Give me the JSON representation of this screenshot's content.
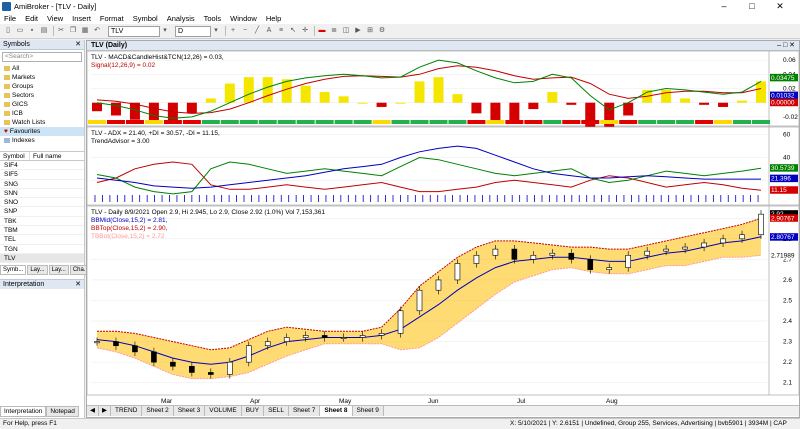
{
  "app": {
    "title": "AmiBroker - [TLV - Daily]",
    "minimize": "–",
    "maximize": "□",
    "close": "✕"
  },
  "menu": [
    "File",
    "Edit",
    "View",
    "Insert",
    "Format",
    "Symbol",
    "Analysis",
    "Tools",
    "Window",
    "Help"
  ],
  "toolbar": {
    "ticker": "TLV",
    "interval": "D"
  },
  "symbols_panel": {
    "title": "Symbols",
    "close": "✕",
    "search_placeholder": "<Search>",
    "tree": [
      "All",
      "Markets",
      "Groups",
      "Sectors",
      "GICS",
      "ICB",
      "Watch Lists",
      "Favourites",
      "Indexes"
    ],
    "col_symbol": "Symbol",
    "col_fullname": "Full name",
    "list": [
      "SIF4",
      "SIF5",
      "SNG",
      "SNN",
      "SNO",
      "SNP",
      "TBK",
      "TBM",
      "TEL",
      "TGN",
      "TLV"
    ],
    "tabs": [
      "Symb...",
      "Lay...",
      "Lay...",
      "Cha..."
    ]
  },
  "interpretation": {
    "title": "Interpretation",
    "close": "✕",
    "tabs": [
      "Interpretation",
      "Notepad"
    ]
  },
  "chart_window": {
    "title": "TLV (Daily)",
    "buttons": "– □ ✕"
  },
  "sheet_nav": [
    "◀",
    "▶"
  ],
  "sheets": [
    "TREND",
    "Sheet 2",
    "Sheet 3",
    "VOLUME",
    "BUY",
    "SELL",
    "Sheet 7",
    "Sheet 8",
    "Sheet 9"
  ],
  "active_sheet": "Sheet 8",
  "status": {
    "left": "For Help, press F1",
    "right": "X: 5/10/2021 | Y: 2.6151 | Undefined, Group 255, Services, Advertising | bvb5901 | 3934M | CAP"
  },
  "colors": {
    "up": "#000000",
    "down": "#d40000",
    "band": "#ffc000",
    "mid": "#0000c0",
    "top": "#c00000",
    "bot": "#ff9999",
    "macd": "#008000",
    "signal": "#c00000",
    "adx": "#0000c0",
    "pdi": "#008000",
    "mdi": "#c00000"
  },
  "chart_data": [
    {
      "type": "bar",
      "title": "TLV - MACD&CandleHist&TCN(12,26) = 0.03,",
      "subtitle": "Signal(12,26,9) = 0.02",
      "ylim": [
        -0.03,
        0.07
      ],
      "yticks": [
        0.06,
        0.04,
        0.02,
        0.0,
        -0.02
      ],
      "value_labels": [
        "0.03475",
        "0.01032",
        "0.00000"
      ],
      "series": [
        {
          "name": "MACD",
          "values": [
            0.0,
            -0.004,
            -0.01,
            -0.018,
            -0.022,
            -0.02,
            -0.012,
            0.0,
            0.012,
            0.022,
            0.03,
            0.035,
            0.038,
            0.04,
            0.038,
            0.035,
            0.036,
            0.05,
            0.06,
            0.056,
            0.045,
            0.035,
            0.028,
            0.03,
            0.04,
            0.035,
            0.01,
            -0.01,
            0.0,
            0.015,
            0.02,
            0.018,
            0.015,
            0.012,
            0.015,
            0.03
          ]
        },
        {
          "name": "Signal",
          "values": [
            0.004,
            0.002,
            -0.002,
            -0.008,
            -0.013,
            -0.015,
            -0.014,
            -0.009,
            0.0,
            0.01,
            0.019,
            0.027,
            0.033,
            0.037,
            0.038,
            0.037,
            0.036,
            0.04,
            0.048,
            0.052,
            0.05,
            0.045,
            0.038,
            0.033,
            0.035,
            0.036,
            0.027,
            0.012,
            0.006,
            0.009,
            0.014,
            0.016,
            0.016,
            0.014,
            0.014,
            0.02
          ]
        }
      ]
    },
    {
      "type": "line",
      "title": "TLV - ADX = 21.40, +DI = 30.57, -DI = 11.15,",
      "subtitle": "TrendAdvisor = 3.00",
      "ylim": [
        0,
        65
      ],
      "yticks": [
        60,
        40,
        20
      ],
      "value_labels": [
        "30.5739",
        "21.396",
        "11.15"
      ],
      "series": [
        {
          "name": "ADX",
          "values": [
            22,
            20,
            18,
            15,
            14,
            13,
            14,
            16,
            18,
            20,
            22,
            24,
            27,
            30,
            32,
            34,
            40,
            45,
            48,
            50,
            48,
            42,
            36,
            30,
            26,
            24,
            22,
            22,
            23,
            24,
            23,
            22,
            21,
            21,
            21,
            21
          ]
        },
        {
          "name": "+DI",
          "values": [
            25,
            22,
            14,
            10,
            8,
            10,
            30,
            36,
            34,
            30,
            26,
            28,
            30,
            28,
            26,
            24,
            32,
            40,
            38,
            34,
            30,
            26,
            24,
            26,
            28,
            30,
            22,
            18,
            20,
            24,
            28,
            26,
            24,
            26,
            28,
            30.6
          ]
        },
        {
          "name": "-DI",
          "values": [
            18,
            22,
            30,
            34,
            36,
            34,
            16,
            12,
            12,
            14,
            16,
            14,
            12,
            14,
            16,
            18,
            14,
            10,
            10,
            12,
            14,
            18,
            20,
            18,
            16,
            14,
            20,
            24,
            22,
            18,
            14,
            16,
            18,
            16,
            13,
            11.2
          ]
        }
      ]
    },
    {
      "type": "line",
      "title": "TLV - Daily 8/9/2021 Open 2.9, Hi 2.945, Lo 2.9, Close 2.92 (1.0%) Vol 7,153,361",
      "legend": [
        "BBMid(Close,15,2) = 2.81,",
        "BBTop(Close,15,2) = 2.90,",
        "TBBot(Close,15,2) = 2.72"
      ],
      "ylim": [
        2.05,
        2.95
      ],
      "yticks": [
        2.9,
        2.8,
        2.7,
        2.6,
        2.5,
        2.4,
        2.3,
        2.2,
        2.1
      ],
      "value_labels": [
        "2.92",
        "2.90767",
        "2.80767",
        "2.71989"
      ],
      "x_labels": [
        "Mar",
        "Apr",
        "May",
        "Jun",
        "Jul",
        "Aug"
      ],
      "close": [
        2.3,
        2.28,
        2.25,
        2.2,
        2.18,
        2.15,
        2.14,
        2.2,
        2.28,
        2.3,
        2.32,
        2.33,
        2.32,
        2.32,
        2.33,
        2.34,
        2.45,
        2.55,
        2.6,
        2.68,
        2.72,
        2.75,
        2.7,
        2.72,
        2.73,
        2.7,
        2.65,
        2.66,
        2.72,
        2.74,
        2.75,
        2.76,
        2.78,
        2.8,
        2.82,
        2.92
      ],
      "bb_mid": [
        2.31,
        2.3,
        2.28,
        2.25,
        2.22,
        2.2,
        2.19,
        2.2,
        2.23,
        2.27,
        2.3,
        2.31,
        2.32,
        2.32,
        2.32,
        2.33,
        2.36,
        2.42,
        2.48,
        2.55,
        2.61,
        2.66,
        2.69,
        2.7,
        2.71,
        2.71,
        2.7,
        2.69,
        2.69,
        2.71,
        2.73,
        2.74,
        2.76,
        2.78,
        2.79,
        2.81
      ],
      "bb_top": [
        2.35,
        2.35,
        2.34,
        2.32,
        2.3,
        2.28,
        2.26,
        2.27,
        2.31,
        2.35,
        2.37,
        2.36,
        2.35,
        2.35,
        2.35,
        2.37,
        2.46,
        2.57,
        2.64,
        2.71,
        2.76,
        2.79,
        2.79,
        2.78,
        2.77,
        2.76,
        2.76,
        2.75,
        2.75,
        2.77,
        2.79,
        2.81,
        2.83,
        2.85,
        2.87,
        2.9
      ],
      "bb_bot": [
        2.27,
        2.25,
        2.22,
        2.18,
        2.14,
        2.12,
        2.12,
        2.13,
        2.15,
        2.19,
        2.23,
        2.26,
        2.29,
        2.29,
        2.29,
        2.29,
        2.26,
        2.27,
        2.32,
        2.39,
        2.46,
        2.53,
        2.59,
        2.62,
        2.65,
        2.66,
        2.64,
        2.63,
        2.63,
        2.65,
        2.67,
        2.67,
        2.69,
        2.71,
        2.71,
        2.72
      ]
    }
  ]
}
